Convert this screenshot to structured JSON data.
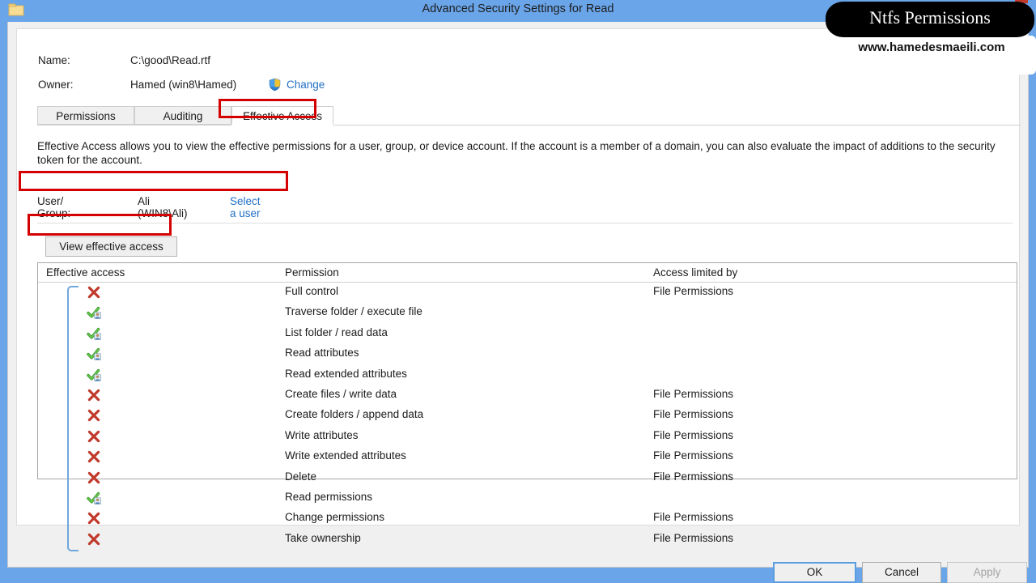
{
  "window": {
    "title": "Advanced Security Settings for Read",
    "folder_icon": "folder-icon",
    "accent_color": "#6aa5e9"
  },
  "header": {
    "name_label": "Name:",
    "name_value": "C:\\good\\Read.rtf",
    "owner_label": "Owner:",
    "owner_value": "Hamed (win8\\Hamed)",
    "change_link": "Change",
    "shield_icon": "uac-shield-icon"
  },
  "tabs": [
    {
      "label": "Permissions",
      "selected": false
    },
    {
      "label": "Auditing",
      "selected": false
    },
    {
      "label": "Effective Access",
      "selected": true
    }
  ],
  "description": "Effective Access allows you to view the effective permissions for a user, group, or device account. If the account is a member of a domain, you can also evaluate the impact of additions to the security token for the account.",
  "usergroup": {
    "label": "User/ Group:",
    "value": "Ali (WIN8\\Ali)",
    "select_link": "Select a user"
  },
  "actions": {
    "view_effective_access": "View effective access"
  },
  "table": {
    "columns": [
      "Effective access",
      "Permission",
      "Access limited by"
    ],
    "rows": [
      {
        "access": "denied",
        "icon": "red-x-icon",
        "permission": "Full control",
        "limited_by": "File Permissions"
      },
      {
        "access": "allowed",
        "icon": "green-check-user-icon",
        "permission": "Traverse folder / execute file",
        "limited_by": ""
      },
      {
        "access": "allowed",
        "icon": "green-check-user-icon",
        "permission": "List folder / read data",
        "limited_by": ""
      },
      {
        "access": "allowed",
        "icon": "green-check-user-icon",
        "permission": "Read attributes",
        "limited_by": ""
      },
      {
        "access": "allowed",
        "icon": "green-check-user-icon",
        "permission": "Read extended attributes",
        "limited_by": ""
      },
      {
        "access": "denied",
        "icon": "red-x-icon",
        "permission": "Create files / write data",
        "limited_by": "File Permissions"
      },
      {
        "access": "denied",
        "icon": "red-x-icon",
        "permission": "Create folders / append data",
        "limited_by": "File Permissions"
      },
      {
        "access": "denied",
        "icon": "red-x-icon",
        "permission": "Write attributes",
        "limited_by": "File Permissions"
      },
      {
        "access": "denied",
        "icon": "red-x-icon",
        "permission": "Write extended attributes",
        "limited_by": "File Permissions"
      },
      {
        "access": "denied",
        "icon": "red-x-icon",
        "permission": "Delete",
        "limited_by": "File Permissions"
      },
      {
        "access": "allowed",
        "icon": "green-check-user-icon",
        "permission": "Read permissions",
        "limited_by": ""
      },
      {
        "access": "denied",
        "icon": "red-x-icon",
        "permission": "Change permissions",
        "limited_by": "File Permissions"
      },
      {
        "access": "denied",
        "icon": "red-x-icon",
        "permission": "Take ownership",
        "limited_by": "File Permissions"
      }
    ]
  },
  "footer": {
    "ok": "OK",
    "cancel": "Cancel",
    "apply": "Apply",
    "apply_disabled": true
  },
  "watermark": {
    "title": "Ntfs Permissions",
    "url": "www.hamedesmaeili.com"
  },
  "annotations": {
    "highlight_color": "#d40000",
    "boxes": [
      "effective-access-tab",
      "user-group-row",
      "view-effective-access-button"
    ]
  }
}
